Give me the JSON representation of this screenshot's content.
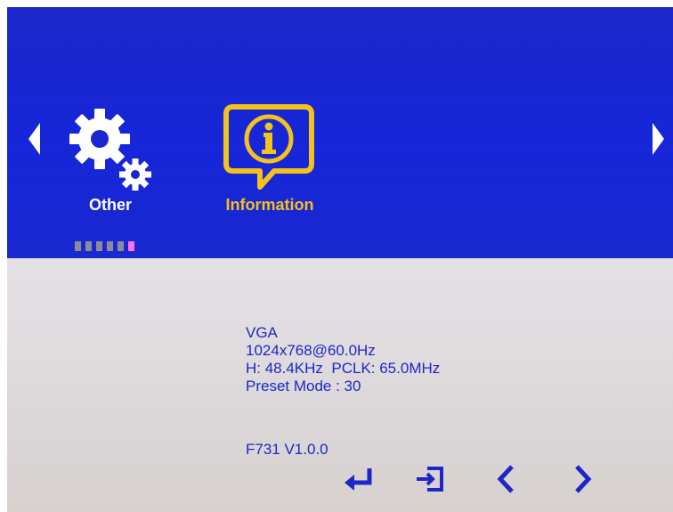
{
  "menu": {
    "tiles": [
      {
        "label": "Other",
        "icon": "gears-icon",
        "selected": false
      },
      {
        "label": "Information",
        "icon": "info-icon",
        "selected": true
      }
    ],
    "page_indicator": {
      "total": 6,
      "active": 6
    }
  },
  "information": {
    "input": "VGA",
    "resolution": "1024x768@60.0Hz",
    "frequency": "H: 48.4KHz  PCLK: 65.0MHz",
    "preset_mode": "Preset Mode : 30",
    "firmware": "F731  V1.0.0"
  },
  "controls": {
    "enter_icon": "enter-icon",
    "exit_icon": "exit-icon",
    "prev_icon": "chevron-left-icon",
    "next_icon": "chevron-right-icon"
  },
  "colors": {
    "header_blue": "#1a28d0",
    "text_blue": "#1d26c8",
    "selected_yellow": "#f4c21a",
    "indicator_active": "#ff6fe8"
  }
}
